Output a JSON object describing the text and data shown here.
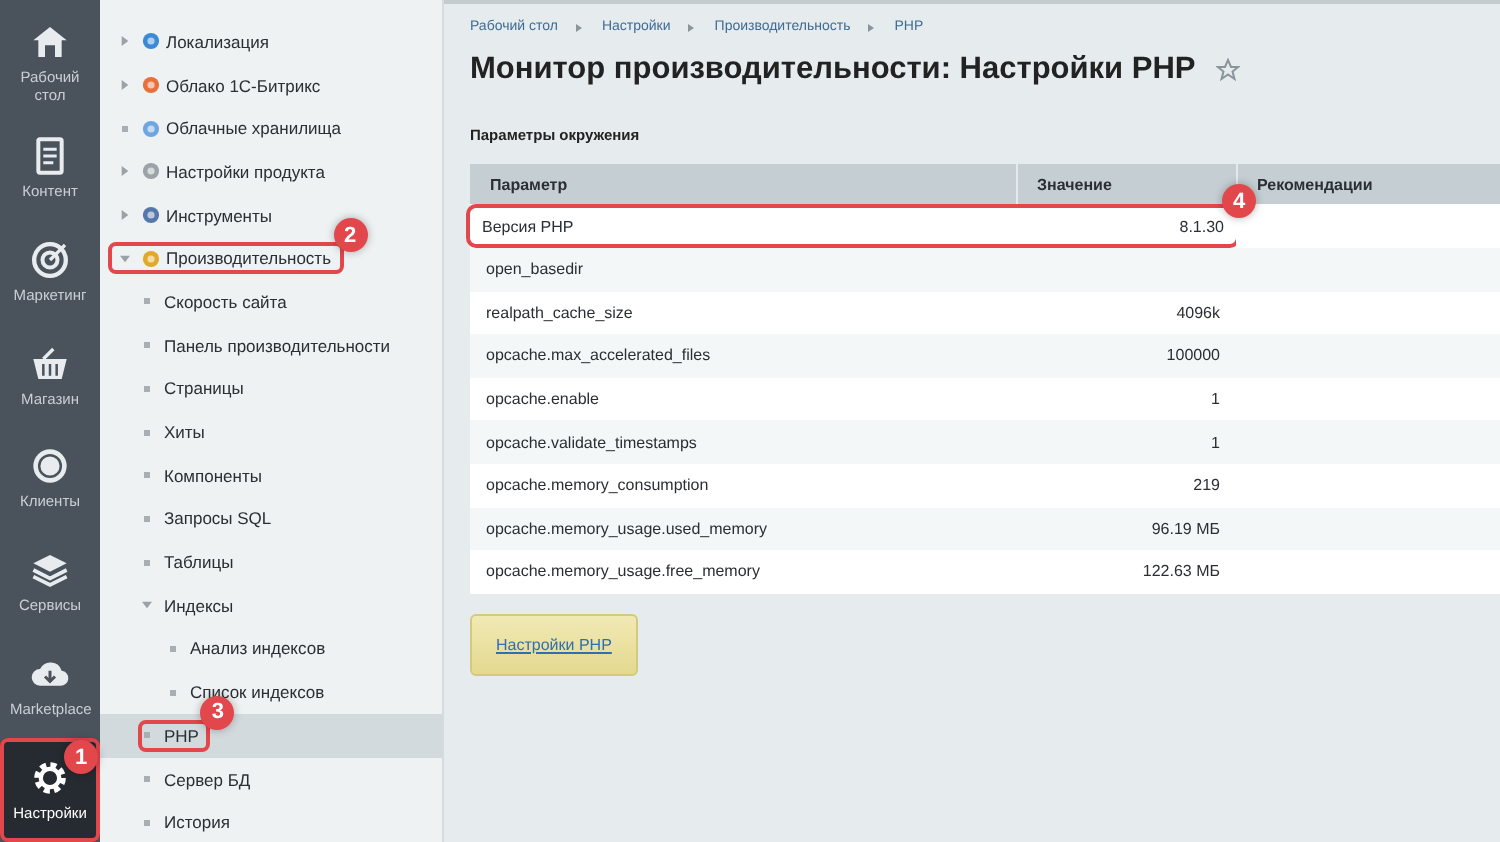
{
  "rail": [
    {
      "label": "Рабочий стол",
      "selected": false
    },
    {
      "label": "Контент",
      "selected": false
    },
    {
      "label": "Маркетинг",
      "selected": false
    },
    {
      "label": "Магазин",
      "selected": false
    },
    {
      "label": "Клиенты",
      "selected": false
    },
    {
      "label": "Сервисы",
      "selected": false
    },
    {
      "label": "Marketplace",
      "selected": false
    },
    {
      "label": "Настройки",
      "selected": true,
      "callout": "1"
    }
  ],
  "tree": [
    {
      "label": "Локализация",
      "kind": "folder",
      "expanded": false,
      "selected": false
    },
    {
      "label": "Облако 1С-Битрикс",
      "kind": "folder",
      "expanded": false,
      "selected": false
    },
    {
      "label": "Облачные хранилища",
      "kind": "leaf",
      "selected": false
    },
    {
      "label": "Настройки продукта",
      "kind": "folder",
      "expanded": false,
      "selected": false
    },
    {
      "label": "Инструменты",
      "kind": "folder",
      "expanded": false,
      "selected": false
    },
    {
      "label": "Производительность",
      "kind": "folder",
      "expanded": true,
      "selected": false,
      "callout": "2",
      "children": [
        {
          "label": "Скорость сайта",
          "kind": "leaf",
          "selected": false
        },
        {
          "label": "Панель производительности",
          "kind": "leaf",
          "selected": false
        },
        {
          "label": "Страницы",
          "kind": "leaf",
          "selected": false
        },
        {
          "label": "Хиты",
          "kind": "leaf",
          "selected": false
        },
        {
          "label": "Компоненты",
          "kind": "leaf",
          "selected": false
        },
        {
          "label": "Запросы SQL",
          "kind": "leaf",
          "selected": false
        },
        {
          "label": "Таблицы",
          "kind": "leaf",
          "selected": false
        },
        {
          "label": "Индексы",
          "kind": "folder",
          "expanded": true,
          "selected": false,
          "children": [
            {
              "label": "Анализ индексов",
              "kind": "leaf",
              "selected": false
            },
            {
              "label": "Список индексов",
              "kind": "leaf",
              "selected": false
            }
          ]
        },
        {
          "label": "PHP",
          "kind": "leaf",
          "selected": true,
          "callout": "3"
        },
        {
          "label": "Сервер БД",
          "kind": "leaf",
          "selected": false
        },
        {
          "label": "История",
          "kind": "leaf",
          "selected": false
        }
      ]
    }
  ],
  "breadcrumbs": [
    "Рабочий стол",
    "Настройки",
    "Производительность",
    "PHP"
  ],
  "title": "Монитор производительности: Настройки PHP",
  "section_title": "Параметры окружения",
  "table": {
    "columns": [
      "Параметр",
      "Значение",
      "Рекомендации"
    ],
    "rows": [
      {
        "param": "Версия PHP",
        "value": "8.1.30",
        "callout": "4"
      },
      {
        "param": "open_basedir",
        "value": ""
      },
      {
        "param": "realpath_cache_size",
        "value": "4096k"
      },
      {
        "param": "opcache.max_accelerated_files",
        "value": "100000"
      },
      {
        "param": "opcache.enable",
        "value": "1"
      },
      {
        "param": "opcache.validate_timestamps",
        "value": "1"
      },
      {
        "param": "opcache.memory_consumption",
        "value": "219"
      },
      {
        "param": "opcache.memory_usage.used_memory",
        "value": "96.19 МБ"
      },
      {
        "param": "opcache.memory_usage.free_memory",
        "value": "122.63 МБ"
      }
    ]
  },
  "button": "Настройки PHP"
}
